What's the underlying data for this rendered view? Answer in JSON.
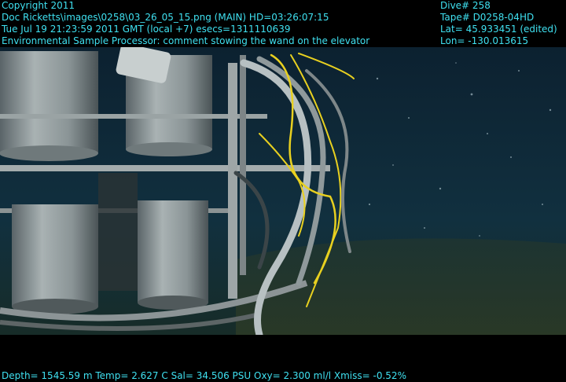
{
  "overlay": {
    "top_left": [
      "Copyright 2011",
      "Doc Ricketts\\images\\0258\\03_26_05_15.png (MAIN)  HD=03:26:07:15",
      "Tue Jul 19 21:23:59 2011 GMT (local +7)  esecs=1311110639",
      "Environmental Sample Processor: comment stowing the wand on the elevator"
    ],
    "top_right": [
      "Dive# 258",
      "Tape# D0258-04HD",
      "Lat= 45.933451 (edited)",
      "Lon= -130.013615"
    ],
    "bottom": "Depth= 1545.59 m  Temp= 2.627 C  Sal= 34.506 PSU  Oxy= 2.300 ml/l  Xmiss= -0.52%"
  },
  "colors": {
    "overlay_text": "#3fe0f0",
    "water": "#0f2a3a",
    "cable_yellow": "#e8d020"
  }
}
